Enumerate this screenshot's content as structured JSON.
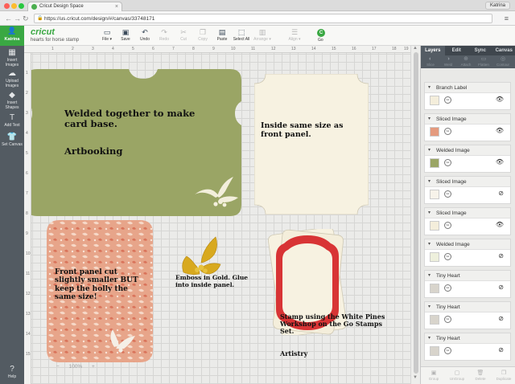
{
  "browser": {
    "tab_title": "Cricut Design Space",
    "url": "https://us.cricut.com/design/#/canvas/33748171",
    "user": "Katrina"
  },
  "header": {
    "user_name": "Katrina",
    "logo": "cricut",
    "project_name": "hearts for horse stamp",
    "tools": [
      {
        "label": "File ▾",
        "icon": "folder-icon",
        "glyph": "▭"
      },
      {
        "label": "Save",
        "icon": "save-icon",
        "glyph": "▣"
      },
      {
        "label": "Undo",
        "icon": "undo-icon",
        "glyph": "↶"
      },
      {
        "label": "Redo",
        "icon": "redo-icon",
        "glyph": "↷"
      },
      {
        "label": "Cut",
        "icon": "cut-icon",
        "glyph": "✂"
      },
      {
        "label": "Copy",
        "icon": "copy-icon",
        "glyph": "❐"
      },
      {
        "label": "Paste",
        "icon": "paste-icon",
        "glyph": "▤"
      },
      {
        "label": "Select All",
        "icon": "select-all-icon",
        "glyph": "⬚"
      },
      {
        "label": "Arrange ▾",
        "icon": "arrange-icon",
        "glyph": "▥"
      },
      {
        "label": "Align ▾",
        "icon": "align-icon",
        "glyph": "☰"
      }
    ],
    "go_label": "Go",
    "go_glyph": "C"
  },
  "left_toolbar": [
    {
      "label": "Insert Images",
      "icon": "insert-images-icon",
      "glyph": "▦"
    },
    {
      "label": "Upload Images",
      "icon": "upload-images-icon",
      "glyph": "☁"
    },
    {
      "label": "Insert Shapes",
      "icon": "insert-shapes-icon",
      "glyph": "◆"
    },
    {
      "label": "Add Text",
      "icon": "add-text-icon",
      "glyph": "T"
    },
    {
      "label": "Set Canvas",
      "icon": "set-canvas-icon",
      "glyph": "👕"
    },
    {
      "label": "Help",
      "icon": "help-icon",
      "glyph": "?"
    }
  ],
  "ruler_top": [
    "1",
    "2",
    "3",
    "4",
    "5",
    "6",
    "7",
    "8",
    "9",
    "10",
    "11",
    "12",
    "13",
    "14",
    "15",
    "16",
    "17",
    "18",
    "19"
  ],
  "ruler_left": [
    "1",
    "2",
    "3",
    "4",
    "5",
    "6",
    "7",
    "8",
    "9",
    "10",
    "11",
    "12",
    "13",
    "14",
    "15"
  ],
  "notes": {
    "welded": "Welded together to make card base.",
    "artbooking": "Artbooking",
    "inside": "Inside same size as front panel.",
    "front": "Front panel cut slightly smaller BUT keep the holly the same size!",
    "emboss": "Emboss in Gold. Glue into inside panel.",
    "stamp": "Stamp using the White Pines Workshop on the Go Stamps Set.",
    "artistry": "Artistry"
  },
  "zoom": {
    "minus": "−",
    "level": "100%",
    "plus": "+"
  },
  "right_panel": {
    "tabs": [
      "Layers",
      "Edit",
      "Sync",
      "Canvas"
    ],
    "actions": [
      {
        "label": "Slice",
        "icon": "slice-icon",
        "glyph": "◐"
      },
      {
        "label": "Weld",
        "icon": "weld-icon",
        "glyph": "◑"
      },
      {
        "label": "Attach",
        "icon": "attach-icon",
        "glyph": "⊕"
      },
      {
        "label": "Flatten",
        "icon": "flatten-icon",
        "glyph": "▭"
      },
      {
        "label": "Contour",
        "icon": "contour-icon",
        "glyph": "◎"
      }
    ],
    "layers": [
      {
        "name": "Branch Label",
        "thumb": "#f4eedb",
        "visibility": "visible"
      },
      {
        "name": "Sliced Image",
        "thumb": "#e49a7e",
        "visibility": "visible"
      },
      {
        "name": "Welded Image",
        "thumb": "#9aa565",
        "visibility": "visible"
      },
      {
        "name": "Sliced Image",
        "thumb": "#f7f3ea",
        "visibility": "hidden"
      },
      {
        "name": "Sliced Image",
        "thumb": "#f4eedb",
        "visibility": "visible"
      },
      {
        "name": "Welded Image",
        "thumb": "#eef0dc",
        "visibility": "hidden"
      },
      {
        "name": "Tiny Heart",
        "thumb": "#d8d4cc",
        "visibility": "hidden"
      },
      {
        "name": "Tiny Heart",
        "thumb": "#d8d4cc",
        "visibility": "hidden"
      },
      {
        "name": "Tiny Heart",
        "thumb": "#d8d4cc",
        "visibility": "hidden"
      }
    ],
    "bottom_actions": [
      {
        "label": "Group",
        "icon": "group-icon",
        "glyph": "▣"
      },
      {
        "label": "UnGroup",
        "icon": "ungroup-icon",
        "glyph": "▢"
      },
      {
        "label": "Delete",
        "icon": "delete-icon",
        "glyph": "🗑"
      },
      {
        "label": "Duplicate",
        "icon": "duplicate-icon",
        "glyph": "❐"
      }
    ]
  },
  "colors": {
    "cricut_green": "#3aa843",
    "sidebar_dark": "#535b62",
    "card_green": "#9aa565",
    "cream": "#f7f2e1",
    "pattern": "#e49a7e",
    "gold": "#d8a91f",
    "red": "#d83435"
  }
}
